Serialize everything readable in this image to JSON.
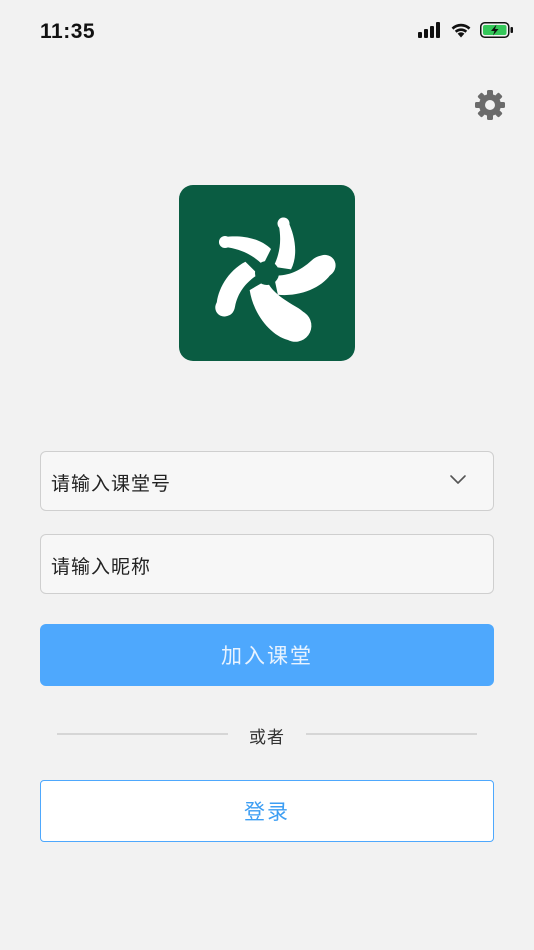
{
  "status_bar": {
    "time": "11:35",
    "icons": [
      "cellular-signal-icon",
      "wifi-icon",
      "battery-charging-icon"
    ]
  },
  "settings": {
    "icon": "gear-icon"
  },
  "logo": {
    "icon": "pinwheel-logo-icon",
    "background_color": "#0a5c42"
  },
  "form": {
    "classroom_placeholder": "请输入课堂号",
    "nickname_placeholder": "请输入昵称",
    "dropdown_icon": "chevron-down-icon"
  },
  "join_button": {
    "label": "加入课堂",
    "color": "#4ea8fd"
  },
  "divider": {
    "text": "或者"
  },
  "login_button": {
    "label": "登录",
    "color": "#3d9ef3"
  }
}
